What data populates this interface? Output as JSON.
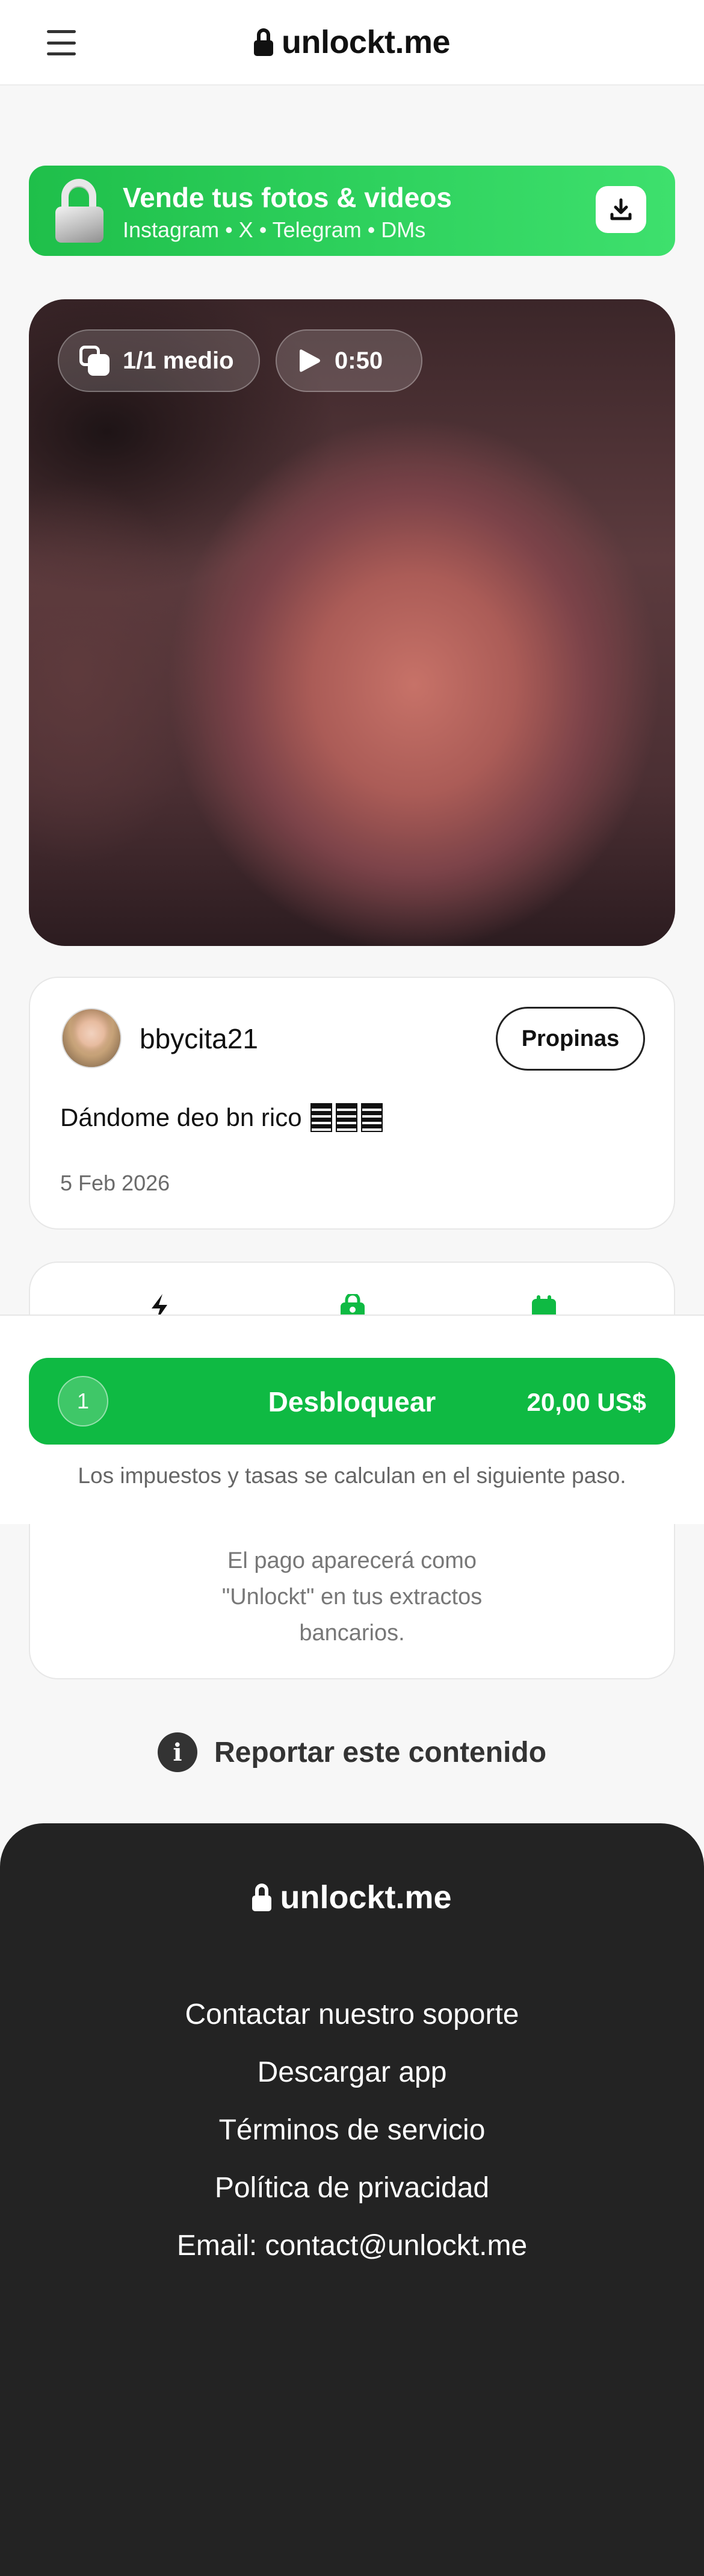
{
  "header": {
    "menu_icon": "hamburger-menu-icon",
    "brand_icon": "lock-icon",
    "brand": "unlockt.me"
  },
  "promo": {
    "title": "Vende tus fotos & videos",
    "subtitle": "Instagram • X • Telegram • DMs",
    "icon": "open-padlock-icon",
    "action_icon": "download-icon",
    "colors": {
      "start": "#1fbf4a",
      "end": "#3ee06d"
    }
  },
  "media": {
    "count": "1/1 medio",
    "count_icon": "copy-icon",
    "duration": "0:50",
    "duration_icon": "play-icon"
  },
  "post": {
    "username": "bbycita21",
    "tip_label": "Propinas",
    "caption": "Dándome deo bn rico",
    "date": "5 Feb 2026"
  },
  "actions": {
    "icons": [
      "bolt-icon",
      "bag-lock-icon",
      "calendar-icon"
    ],
    "billing_lines": [
      "El pago aparecerá como",
      "\"Unlockt\" en tus extractos",
      "bancarios."
    ]
  },
  "unlock": {
    "quantity": "1",
    "label": "Desbloquear",
    "price": "20,00 US$",
    "tax_note": "Los impuestos y tasas se calculan en el siguiente paso.",
    "color": "#0fba43"
  },
  "report": {
    "icon": "info-icon",
    "label": "Reportar este contenido"
  },
  "footer": {
    "brand": "unlockt.me",
    "links": [
      "Contactar nuestro soporte",
      "Descargar app",
      "Términos de servicio",
      "Política de privacidad",
      "Email: contact@unlockt.me"
    ],
    "background": "#232323"
  }
}
